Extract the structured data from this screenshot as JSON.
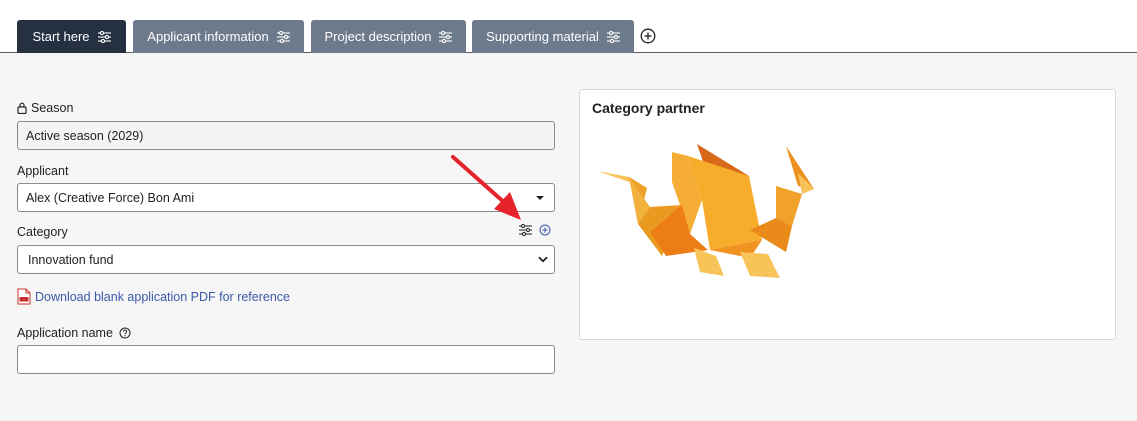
{
  "tabs": [
    {
      "label": "Start here",
      "active": true
    },
    {
      "label": "Applicant information",
      "active": false
    },
    {
      "label": "Project description",
      "active": false
    },
    {
      "label": "Supporting material",
      "active": false
    }
  ],
  "add_tab_icon": "plus-circle-icon",
  "form": {
    "season_label": "Season",
    "season_value": "Active season (2029)",
    "applicant_label": "Applicant",
    "applicant_value": "Alex (Creative Force) Bon Ami",
    "category_label": "Category",
    "category_value": "Innovation fund",
    "pdf_link": "Download blank application PDF for reference",
    "application_name_label": "Application name",
    "application_name_value": "",
    "application_name_placeholder": ""
  },
  "partner": {
    "title": "Category partner",
    "logo_icon": "origami-dragon-logo"
  },
  "colors": {
    "tab_active": "#253141",
    "tab_inactive": "#6d7a8c",
    "link": "#3c59a8",
    "annotation_arrow": "#e5232b"
  }
}
